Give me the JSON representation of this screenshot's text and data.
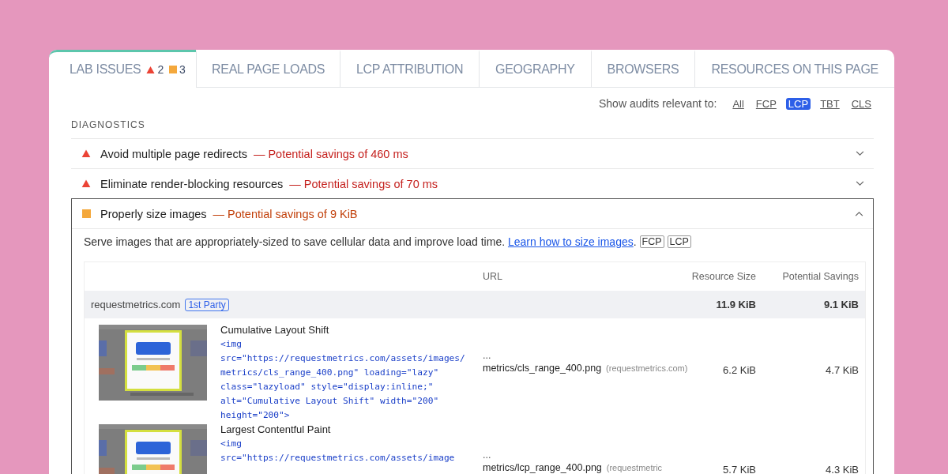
{
  "tabs": [
    {
      "label": "LAB ISSUES",
      "selected": true,
      "counts": [
        {
          "kind": "fail",
          "text": "2"
        },
        {
          "kind": "average",
          "text": "3"
        }
      ]
    },
    {
      "label": "REAL PAGE LOADS",
      "selected": false
    },
    {
      "label": "LCP ATTRIBUTION",
      "selected": false
    },
    {
      "label": "GEOGRAPHY",
      "selected": false
    },
    {
      "label": "BROWSERS",
      "selected": false
    },
    {
      "label": "RESOURCES ON THIS PAGE",
      "selected": false
    }
  ],
  "filter": {
    "label": "Show audits relevant to:",
    "options": [
      {
        "label": "All",
        "selected": false
      },
      {
        "label": "FCP",
        "selected": false
      },
      {
        "label": "LCP",
        "selected": true
      },
      {
        "label": "TBT",
        "selected": false
      },
      {
        "label": "CLS",
        "selected": false
      }
    ]
  },
  "section_title": "DIAGNOSTICS",
  "audits": [
    {
      "kind": "fail",
      "title": "Avoid multiple page redirects",
      "savings": "— Potential savings of 460 ms",
      "expanded": false
    },
    {
      "kind": "fail",
      "title": "Eliminate render-blocking resources",
      "savings": "— Potential savings of 70 ms",
      "expanded": false
    },
    {
      "kind": "average",
      "title": "Properly size images",
      "savings": "— Potential savings of 9 KiB",
      "expanded": true
    }
  ],
  "details": {
    "description": "Serve images that are appropriately-sized to save cellular data and improve load time.",
    "link": "Learn how to size images",
    "after_link": ".",
    "tags": [
      "FCP",
      "LCP"
    ],
    "table": {
      "columns": [
        "URL",
        "Resource Size",
        "Potential Savings"
      ],
      "group": {
        "domain": "requestmetrics.com",
        "badge": "1st Party",
        "resource_size": "11.9 KiB",
        "savings": "9.1 KiB"
      },
      "rows": [
        {
          "title": "Cumulative Layout Shift",
          "snippet": "<img src=\"https://requestmetrics.com/assets/images/metrics/cls_range_400.png\" loading=\"lazy\" class=\"lazyload\" style=\"display:inline;\" alt=\"Cumulative Layout Shift\" width=\"200\" height=\"200\">",
          "url_prefix": "...",
          "url": "metrics/cls_range_400.png",
          "host": "(requestmetrics.com)",
          "resource_size": "6.2 KiB",
          "savings": "4.7 KiB"
        },
        {
          "title": "Largest Contentful Paint",
          "snippet": "<img src=\"https://requestmetrics.com/assets/image",
          "url_prefix": "...",
          "url": "metrics/lcp_range_400.png",
          "host": "(requestmetric",
          "resource_size": "5.7 KiB",
          "savings": "4.3 KiB"
        }
      ]
    }
  }
}
